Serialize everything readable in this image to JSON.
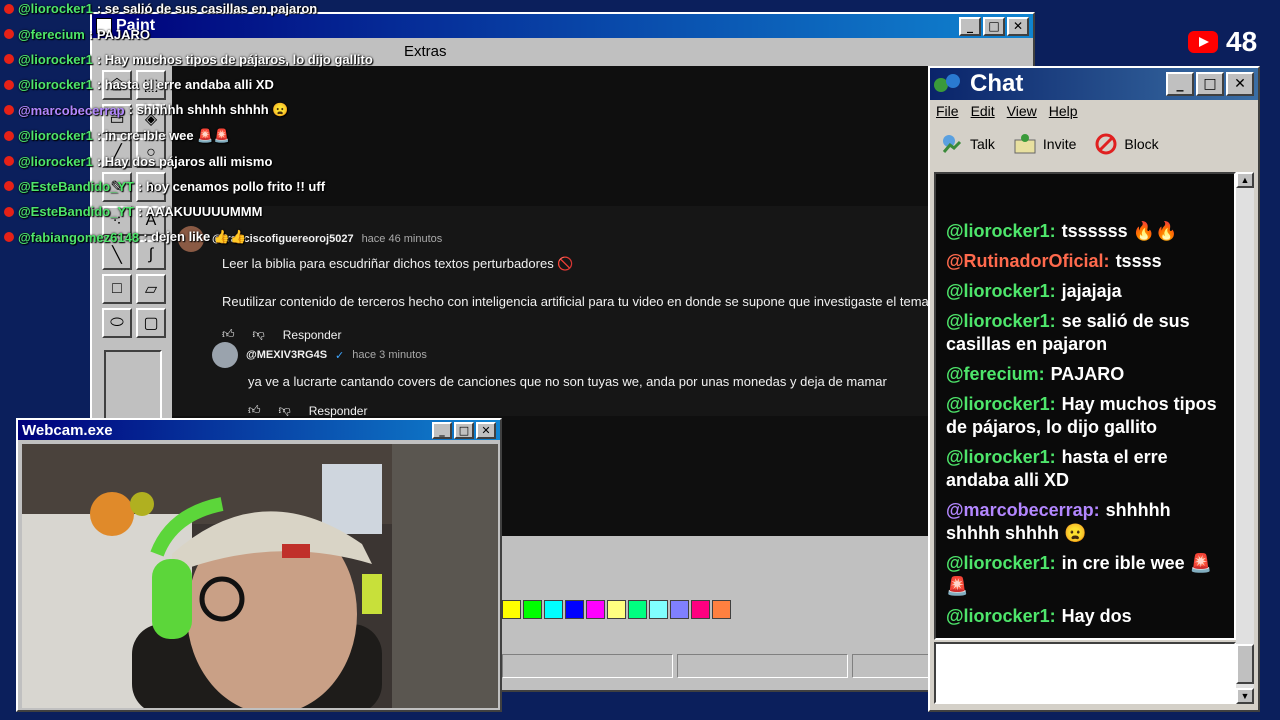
{
  "paint": {
    "title": "Paint",
    "menu": [
      "Extras"
    ]
  },
  "youtube": {
    "comment1": {
      "user": "@franciscofiguereoroj5027",
      "time": "hace 46 minutos",
      "line1": "Leer la biblia para escudriñar dichos textos perturbadores 🚫",
      "line2": "Reutilizar contenido de terceros hecho con inteligencia artificial para tu video en donde se supone que investigaste el tema ante",
      "reply": "Responder"
    },
    "comment2": {
      "user": "@MEXIV3RG4S",
      "time": "hace 3 minutos",
      "text": "ya ve a lucrarte cantando covers de canciones que no son tuyas we, anda por unas monedas y deja de mamar",
      "reply": "Responder"
    }
  },
  "overlay_chat": [
    {
      "user": "@liorocker1",
      "text": ": se salió de sus casillas en pajaron",
      "purple": false
    },
    {
      "user": "@ferecium",
      "text": ": PAJARO",
      "purple": false
    },
    {
      "user": "@liorocker1",
      "text": ": Hay muchos tipos de pájaros, lo dijo gallito",
      "purple": false
    },
    {
      "user": "@liorocker1",
      "text": ": hasta el erre andaba alli XD",
      "purple": false
    },
    {
      "user": "@marcobecerrap",
      "text": ": shhhhh shhhh shhhh 😦",
      "purple": true
    },
    {
      "user": "@liorocker1",
      "text": ": in cre ible wee 🚨🚨",
      "purple": false
    },
    {
      "user": "@liorocker1",
      "text": ": Hay dos pájaros alli mismo",
      "purple": false
    },
    {
      "user": "@EsteBandido_YT",
      "text": ": hoy cenamos pollo frito !! uff",
      "purple": false
    },
    {
      "user": "@EsteBandido_YT",
      "text": ": AAAKUUUUUMMM",
      "purple": false
    },
    {
      "user": "@fabiangomez6148",
      "text": ": dejen like 👍👍",
      "purple": false
    }
  ],
  "chat_window": {
    "title": "Chat",
    "menu": [
      "File",
      "Edit",
      "View",
      "Help"
    ],
    "tools": [
      "Talk",
      "Invite",
      "Block"
    ],
    "messages": [
      {
        "user": "@liorocker1:",
        "text": "tssssss 🔥🔥",
        "color": "green"
      },
      {
        "user": "@RutinadorOficial:",
        "text": "tssss",
        "color": "red"
      },
      {
        "user": "@liorocker1:",
        "text": "jajajaja",
        "color": "green"
      },
      {
        "user": "@liorocker1:",
        "text": "se salió de sus casillas en pajaron",
        "color": "green"
      },
      {
        "user": "@ferecium:",
        "text": "PAJARO",
        "color": "green"
      },
      {
        "user": "@liorocker1:",
        "text": "Hay muchos tipos de pájaros, lo dijo gallito",
        "color": "green"
      },
      {
        "user": "@liorocker1:",
        "text": "hasta el erre andaba alli XD",
        "color": "green"
      },
      {
        "user": "@marcobecerrap:",
        "text": "shhhhh shhhh shhhh 😦",
        "color": "purple"
      },
      {
        "user": "@liorocker1:",
        "text": "in cre ible wee 🚨🚨",
        "color": "green"
      },
      {
        "user": "@liorocker1:",
        "text": "Hay dos",
        "color": "green"
      }
    ]
  },
  "webcam": {
    "title": "Webcam.exe"
  },
  "viewer_count": "48",
  "palette_colors": [
    "#ffff00",
    "#00ff00",
    "#00ffff",
    "#0000ff",
    "#ff00ff",
    "#ffff80",
    "#00ff80",
    "#80ffff",
    "#8080ff",
    "#ff0080",
    "#ff8040"
  ]
}
